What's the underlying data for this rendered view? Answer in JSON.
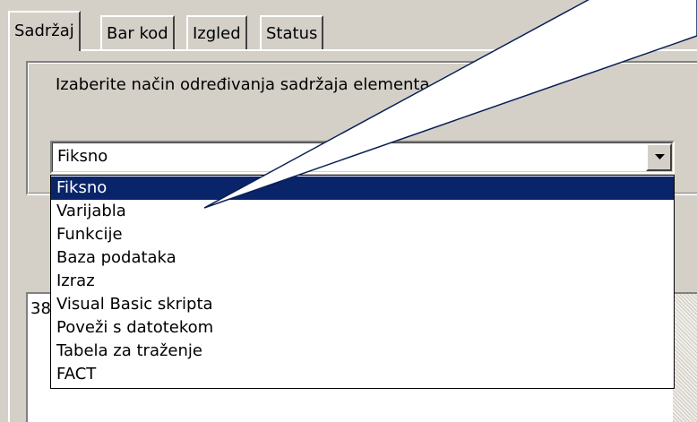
{
  "tabs": [
    {
      "label": "Sadržaj",
      "active": true
    },
    {
      "label": "Bar kod",
      "active": false
    },
    {
      "label": "Izgled",
      "active": false
    },
    {
      "label": "Status",
      "active": false
    }
  ],
  "instruction": "Izaberite način određivanja sadržaja elementa",
  "combo": {
    "value": "Fiksno",
    "button_icon": "chevron-down-icon"
  },
  "dropdown": {
    "selected_index": 0,
    "items": [
      "Fiksno",
      "Varijabla",
      "Funkcije",
      "Baza podataka",
      "Izraz",
      "Visual Basic skripta",
      "Poveži s datotekom",
      "Tabela za traženje",
      "FACT"
    ]
  },
  "textarea": {
    "value": "38"
  },
  "colors": {
    "dialog_bg": "#d4d0c8",
    "selection_bg": "#0a246a",
    "callout_stroke": "#0a1e56"
  }
}
